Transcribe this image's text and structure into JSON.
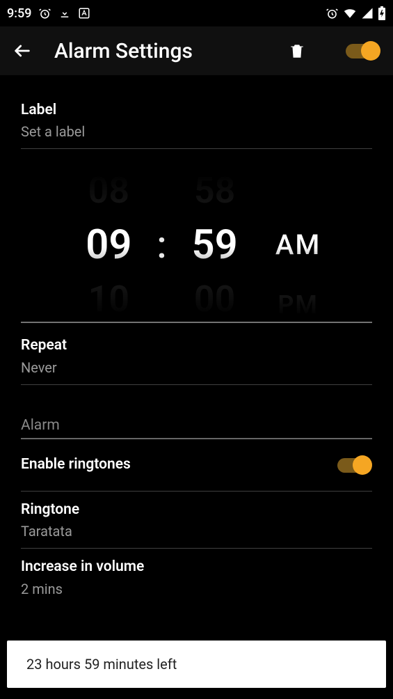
{
  "status_bar": {
    "time": "9:59",
    "icons_left": [
      "alarm",
      "download",
      "language-a"
    ],
    "icons_right": [
      "alarm",
      "wifi",
      "signal",
      "battery"
    ]
  },
  "app_bar": {
    "title": "Alarm Settings"
  },
  "rows": {
    "label": {
      "title": "Label",
      "sub": "Set a label"
    },
    "repeat": {
      "title": "Repeat",
      "sub": "Never"
    },
    "section_header": "Alarm",
    "enable_ringtones": {
      "title": "Enable ringtones",
      "enabled": true
    },
    "ringtone": {
      "title": "Ringtone",
      "sub": "Taratata"
    },
    "increase_volume": {
      "title": "Increase in volume",
      "sub": "2 mins"
    }
  },
  "time_picker": {
    "hour": "09",
    "minute": "59",
    "ampm": "AM",
    "hour_above": "08",
    "hour_below": "10",
    "minute_above": "58",
    "minute_below": "00",
    "ampm_below": "PM"
  },
  "snackbar": "23 hours 59 minutes  left",
  "accent": "#f5a623"
}
